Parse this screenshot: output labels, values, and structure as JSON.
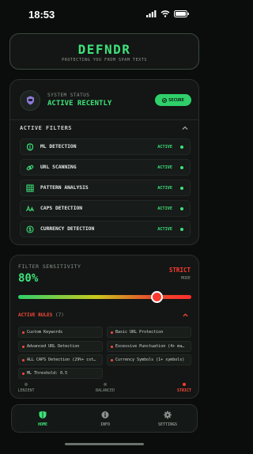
{
  "status_bar": {
    "time": "18:53"
  },
  "header": {
    "title": "DEFNDR",
    "tagline": "PROTECTING YOU FROM SPAM TEXTS"
  },
  "system": {
    "label": "SYSTEM STATUS",
    "value": "ACTIVE RECENTLY",
    "badge": "SECURE"
  },
  "filters": {
    "title": "ACTIVE FILTERS",
    "items": [
      {
        "name": "ML DETECTION",
        "status": "ACTIVE",
        "icon": "brain-icon"
      },
      {
        "name": "URL SCANNING",
        "status": "ACTIVE",
        "icon": "link-icon"
      },
      {
        "name": "PATTERN ANALYSIS",
        "status": "ACTIVE",
        "icon": "grid-icon"
      },
      {
        "name": "CAPS DETECTION",
        "status": "ACTIVE",
        "icon": "text-case-icon"
      },
      {
        "name": "CURRENCY DETECTION",
        "status": "ACTIVE",
        "icon": "currency-icon"
      }
    ]
  },
  "sensitivity": {
    "label": "FILTER SENSITIVITY",
    "value": "80%",
    "level": 0.8,
    "mode": "STRICT",
    "mode_label": "MODE",
    "levels": [
      "LENIENT",
      "BALANCED",
      "STRICT"
    ]
  },
  "rules": {
    "title": "ACTIVE RULES",
    "count": "(7)",
    "items": [
      "Custom Keywords",
      "Basic URL Protection",
      "Advanced URL Detection",
      "Excessive Punctuation (4+ ma…",
      "ALL CAPS Detection (29%+ cst…",
      "Currency Symbols (1+ symbols)",
      "ML Threshold: 0.5"
    ]
  },
  "nav": {
    "items": [
      {
        "label": "HOME"
      },
      {
        "label": "INFO"
      },
      {
        "label": "SETTINGS"
      }
    ]
  },
  "colors": {
    "accent": "#3ee27a",
    "danger": "#ff3b30",
    "background": "#0b0d0c"
  }
}
